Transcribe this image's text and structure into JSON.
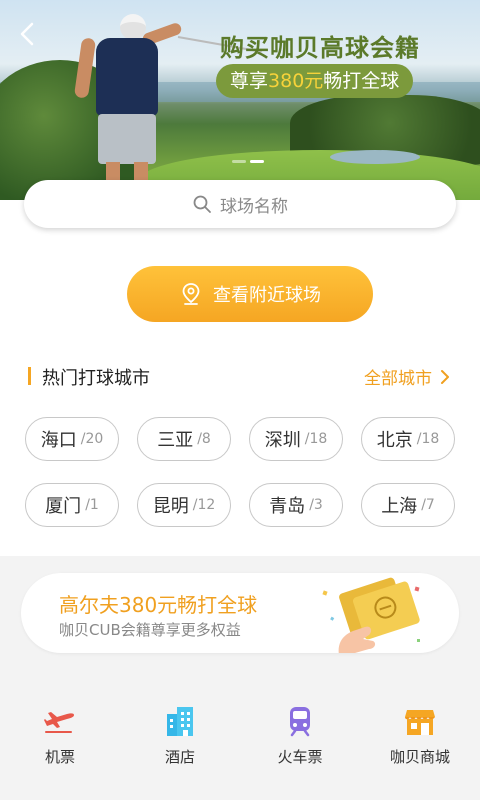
{
  "hero": {
    "promo_title": "购买咖贝高球会籍",
    "promo_prefix": "尊享",
    "promo_price": "380元",
    "promo_suffix": "畅打全球"
  },
  "search": {
    "placeholder": "球场名称"
  },
  "nearby_button": {
    "label": "查看附近球场"
  },
  "hot_cities": {
    "title": "热门打球城市",
    "all_label": "全部城市",
    "cities": [
      {
        "name": "海口",
        "count": "/20"
      },
      {
        "name": "三亚",
        "count": "/8"
      },
      {
        "name": "深圳",
        "count": "/18"
      },
      {
        "name": "北京",
        "count": "/18"
      },
      {
        "name": "厦门",
        "count": "/1"
      },
      {
        "name": "昆明",
        "count": "/12"
      },
      {
        "name": "青岛",
        "count": "/3"
      },
      {
        "name": "上海",
        "count": "/7"
      }
    ]
  },
  "promo_card": {
    "title": "高尔夫380元畅打全球",
    "subtitle": "咖贝CUB会籍尊享更多权益"
  },
  "bottom_nav": [
    {
      "label": "机票",
      "icon": "airplane-icon",
      "color": "#e8584a"
    },
    {
      "label": "酒店",
      "icon": "hotel-icon",
      "color": "#35b7e8"
    },
    {
      "label": "火车票",
      "icon": "train-icon",
      "color": "#8a6fe0"
    },
    {
      "label": "咖贝商城",
      "icon": "store-icon",
      "color": "#f5a623"
    }
  ],
  "colors": {
    "accent": "#f5a623",
    "promo_green": "#7c9a3c"
  }
}
